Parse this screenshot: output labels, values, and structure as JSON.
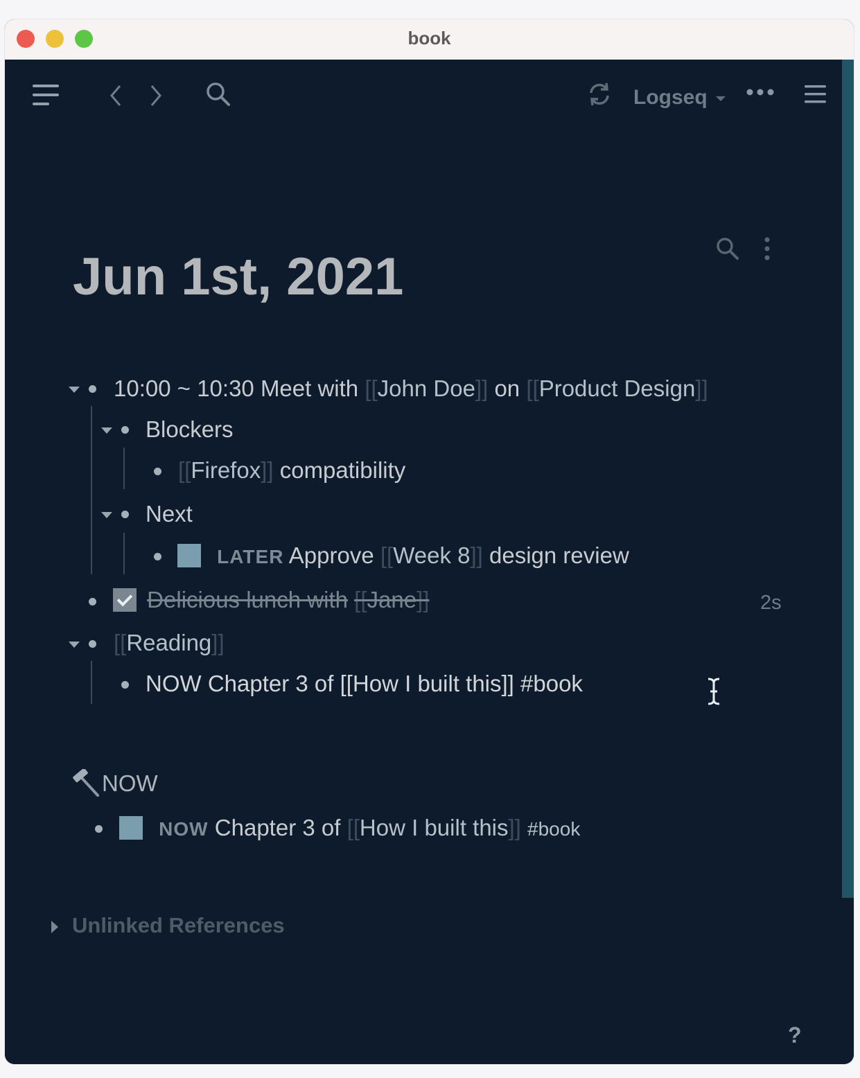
{
  "window": {
    "title": "book"
  },
  "toolbar": {
    "repo_label": "Logseq",
    "more_label": "•••"
  },
  "page": {
    "title": "Jun 1st, 2021"
  },
  "blocks": {
    "meeting": {
      "time": "10:00 ~ 10:30 Meet with",
      "open": "[[",
      "close": "]]",
      "person": "John Doe",
      "on": "on",
      "project": "Product Design"
    },
    "blockers": {
      "label": "Blockers"
    },
    "firefox": {
      "open": "[[",
      "close": "]]",
      "link": "Firefox",
      "rest": "compatibility"
    },
    "next": {
      "label": "Next"
    },
    "later": {
      "marker": "LATER",
      "approve": "Approve",
      "open": "[[",
      "close": "]]",
      "link": "Week 8",
      "rest": "design review"
    },
    "lunch": {
      "text": "Delicious lunch with",
      "open": "[[",
      "close": "]]",
      "link": "Jane",
      "time_ago": "2s"
    },
    "reading": {
      "open": "[[",
      "close": "]]",
      "link": "Reading"
    },
    "now_raw": {
      "text": "NOW Chapter 3 of [[How I built this]] #book"
    }
  },
  "now_section": {
    "icon_glyph": "🔨",
    "heading": "NOW",
    "item": {
      "marker": "NOW",
      "text": "Chapter 3 of",
      "open": "[[",
      "close": "]]",
      "link": "How I built this",
      "tag": "#book"
    }
  },
  "unlinked": {
    "label": "Unlinked References"
  },
  "help": {
    "label": "?"
  },
  "colors": {
    "background": "#0d1b2c",
    "accent": "#1f5564",
    "checkbox": "#7a9eae"
  }
}
